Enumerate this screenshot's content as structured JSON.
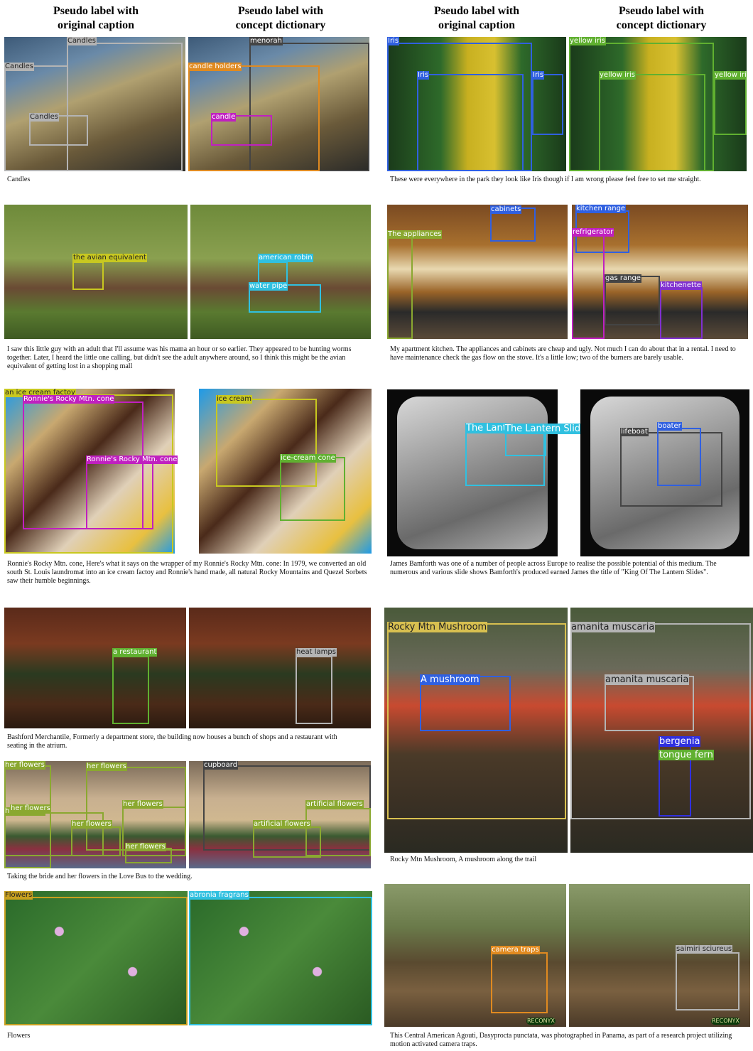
{
  "headers": {
    "left_orig_1": "Pseudo label with",
    "left_orig_2": "original caption",
    "left_dict_1": "Pseudo label with",
    "left_dict_2": "concept dictionary",
    "right_orig_1": "Pseudo label with",
    "right_orig_2": "original caption",
    "right_dict_1": "Pseudo label with",
    "right_dict_2": "concept dictionary"
  },
  "colors": {
    "gray": "#b4b4b4",
    "magenta": "#c020c0",
    "orange": "#e08a20",
    "yellow": "#c8c820",
    "cyan": "#30c0e0",
    "blue": "#3060e0",
    "green": "#60b030",
    "purple": "#8030d0",
    "olive": "#8aa830",
    "dark": "#444444"
  },
  "examples": {
    "candles": {
      "orig_labels": [
        "Candles",
        "Candles",
        "Candles"
      ],
      "dict_labels": [
        "menorah",
        "candle holders",
        "candle"
      ],
      "caption": "Candles"
    },
    "bird": {
      "orig_labels": [
        "the avian equivalent"
      ],
      "dict_labels": [
        "american robin",
        "water pipe"
      ],
      "caption": "I saw this little guy with an adult that I'll assume was his mama an hour or so earlier. They appeared to be hunting worms together. Later, I heard the little one calling, but didn't see the adult anywhere around, so I think this might be the avian equivalent of getting lost in a shopping mall"
    },
    "icecream": {
      "orig_labels": [
        "an ice cream factoy",
        "Ronnie's Rocky Mtn. cone",
        "Ronnie's Rocky Mtn. cone"
      ],
      "dict_labels": [
        "ice cream",
        "ice-cream cone"
      ],
      "caption": "Ronnie's Rocky Mtn. cone, Here's what it says on the wrapper of my Ronnie's Rocky Mtn. cone: In 1979, we converted an old south St. Louis laundromat into an ice cream factoy and Ronnie's hand made, all natural Rocky Mountains and Quezel Sorbets saw their humble beginnings."
    },
    "restaurant": {
      "orig_labels": [
        "a restaurant"
      ],
      "dict_labels": [
        "heat lamps"
      ],
      "caption": "Bashford Merchantile, Formerly a department store, the building now houses a bunch of shops and a restaurant with seating in the atrium."
    },
    "bride": {
      "orig_labels": [
        "her flowers",
        "her flowers",
        "her flowers",
        "her flowers",
        "her flowers",
        "her flowers",
        "her flowers"
      ],
      "dict_labels": [
        "cupboard",
        "artificial flowers",
        "artificial flowers"
      ],
      "caption": "Taking the bride and her flowers in the Love Bus to the wedding."
    },
    "flowers": {
      "orig_labels": [
        "Flowers"
      ],
      "dict_labels": [
        "abronia fragrans"
      ],
      "caption": "Flowers"
    },
    "iris": {
      "orig_labels": [
        "Iris",
        "Iris",
        "Iris"
      ],
      "dict_labels": [
        "yellow iris",
        "yellow iris",
        "yellow iris"
      ],
      "caption": "These were everywhere in the park they look like Iris though if I am wrong please feel free to set me straight."
    },
    "kitchen": {
      "orig_labels": [
        "cabinets",
        "The appliances"
      ],
      "dict_labels": [
        "kitchen range",
        "refrigerator",
        "gas range",
        "kitchenette"
      ],
      "caption": "My apartment kitchen. The appliances and cabinets are cheap and ugly. Not much I can do about that in a rental. I need to have maintenance check the gas flow on the stove. It's a little low; two of the burners are barely usable."
    },
    "lantern": {
      "orig_labels": [
        "The Lantern Slides",
        "The Lantern Slides"
      ],
      "dict_labels": [
        "lifeboat",
        "boater"
      ],
      "caption": "James Bamforth was one of a number of people across Europe to realise the possible potential of this medium. The numerous and various slide shows Bamforth's produced earned James the title of \"King Of The Lantern Slides\"."
    },
    "mushroom": {
      "orig_labels": [
        "Rocky Mtn Mushroom",
        "A mushroom"
      ],
      "dict_labels": [
        "amanita muscaria",
        "amanita muscaria",
        "bergenia",
        "tongue fern"
      ],
      "caption": "Rocky Mtn Mushroom, A mushroom along the trail"
    },
    "agouti": {
      "orig_labels": [
        "camera traps"
      ],
      "dict_labels": [
        "saimiri sciureus"
      ],
      "watermark": "RECONYX",
      "caption": "This Central American Agouti, Dasyprocta punctata, was photographed in Panama, as part of a research project utilizing motion activated camera traps."
    }
  }
}
